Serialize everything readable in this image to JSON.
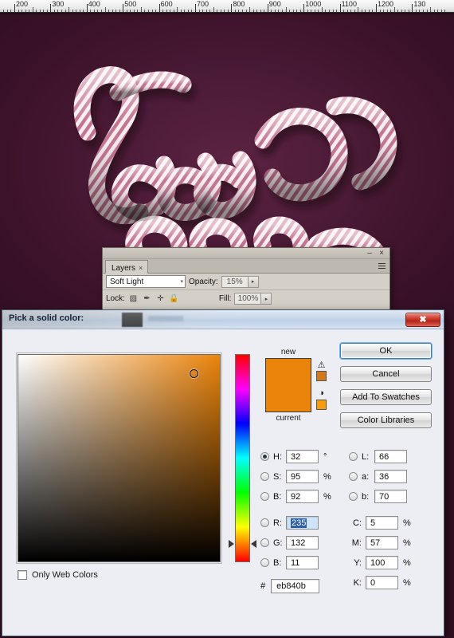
{
  "ruler": {
    "labels": [
      "200",
      "300",
      "400",
      "500",
      "600",
      "700",
      "800",
      "900",
      "1000",
      "1100",
      "1200",
      "130"
    ]
  },
  "canvas": {
    "background_color": "#3b1228",
    "artwork_description": "candy-cane-striped-script-lettering"
  },
  "layers_panel": {
    "tab_label": "Layers",
    "tab_close": "×",
    "minimize": "–",
    "close": "×",
    "blend_mode": "Soft Light",
    "blend_caret": "▾",
    "opacity_label": "Opacity:",
    "opacity_value": "15%",
    "fill_label": "Fill:",
    "fill_value": "100%",
    "lock_label": "Lock:",
    "stepper_caret": "▸",
    "lock_icons": [
      {
        "name": "lock-transparent-pixels-icon",
        "glyph": "▨"
      },
      {
        "name": "lock-image-pixels-icon",
        "glyph": "✒"
      },
      {
        "name": "lock-position-icon",
        "glyph": "✛"
      },
      {
        "name": "lock-all-icon",
        "glyph": "🔒"
      }
    ]
  },
  "picker": {
    "title": "Pick a solid color:",
    "close_glyph": "✖",
    "preview": {
      "new_label": "new",
      "current_label": "current",
      "color": "#eb840b",
      "gamut_warning_icon": "⚠",
      "gamut_warning_swatch": "#d2781d",
      "web_safe_icon": "◑",
      "web_safe_swatch": "#f99c0b"
    },
    "buttons": [
      {
        "name": "ok-button",
        "label": "OK",
        "default": true
      },
      {
        "name": "cancel-button",
        "label": "Cancel",
        "default": false
      },
      {
        "name": "add-to-swatches-button",
        "label": "Add To Swatches",
        "default": false
      },
      {
        "name": "color-libraries-button",
        "label": "Color Libraries",
        "default": false
      }
    ],
    "only_web_colors": {
      "label": "Only Web Colors",
      "checked": false
    },
    "hsb": [
      {
        "name": "hue",
        "label": "H:",
        "value": "32",
        "unit": "°",
        "selected": true
      },
      {
        "name": "saturation",
        "label": "S:",
        "value": "95",
        "unit": "%",
        "selected": false
      },
      {
        "name": "brightness",
        "label": "B:",
        "value": "92",
        "unit": "%",
        "selected": false
      }
    ],
    "rgb": [
      {
        "name": "red",
        "label": "R:",
        "value": "235",
        "unit": "",
        "selected": false,
        "highlighted": true
      },
      {
        "name": "green",
        "label": "G:",
        "value": "132",
        "unit": "",
        "selected": false,
        "highlighted": false
      },
      {
        "name": "blue",
        "label": "B:",
        "value": "11",
        "unit": "",
        "selected": false,
        "highlighted": false
      }
    ],
    "lab": [
      {
        "name": "lightness",
        "label": "L:",
        "value": "66",
        "unit": "",
        "selected": false
      },
      {
        "name": "lab-a",
        "label": "a:",
        "value": "36",
        "unit": "",
        "selected": false
      },
      {
        "name": "lab-b",
        "label": "b:",
        "value": "70",
        "unit": "",
        "selected": false
      }
    ],
    "cmyk": [
      {
        "name": "cyan",
        "label": "C:",
        "value": "5",
        "unit": "%"
      },
      {
        "name": "magenta",
        "label": "M:",
        "value": "57",
        "unit": "%"
      },
      {
        "name": "yellow",
        "label": "Y:",
        "value": "100",
        "unit": "%"
      },
      {
        "name": "black",
        "label": "K:",
        "value": "0",
        "unit": "%"
      }
    ],
    "hex": {
      "prefix": "#",
      "value": "eb840b"
    }
  }
}
